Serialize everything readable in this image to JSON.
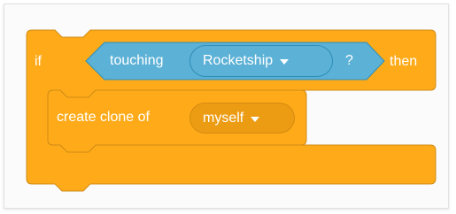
{
  "if_block": {
    "if_label": "if",
    "then_label": "then",
    "color": "#ffab19",
    "border_color": "#cf8b17"
  },
  "condition": {
    "touching_label": "touching",
    "target_value": "Rocketship",
    "question_mark": "?",
    "color": "#5cb1d6",
    "border_color": "#2e8eb8"
  },
  "clone_block": {
    "label": "create clone of",
    "target_value": "myself",
    "color": "#ffab19",
    "menu_color": "#ec9c13"
  }
}
